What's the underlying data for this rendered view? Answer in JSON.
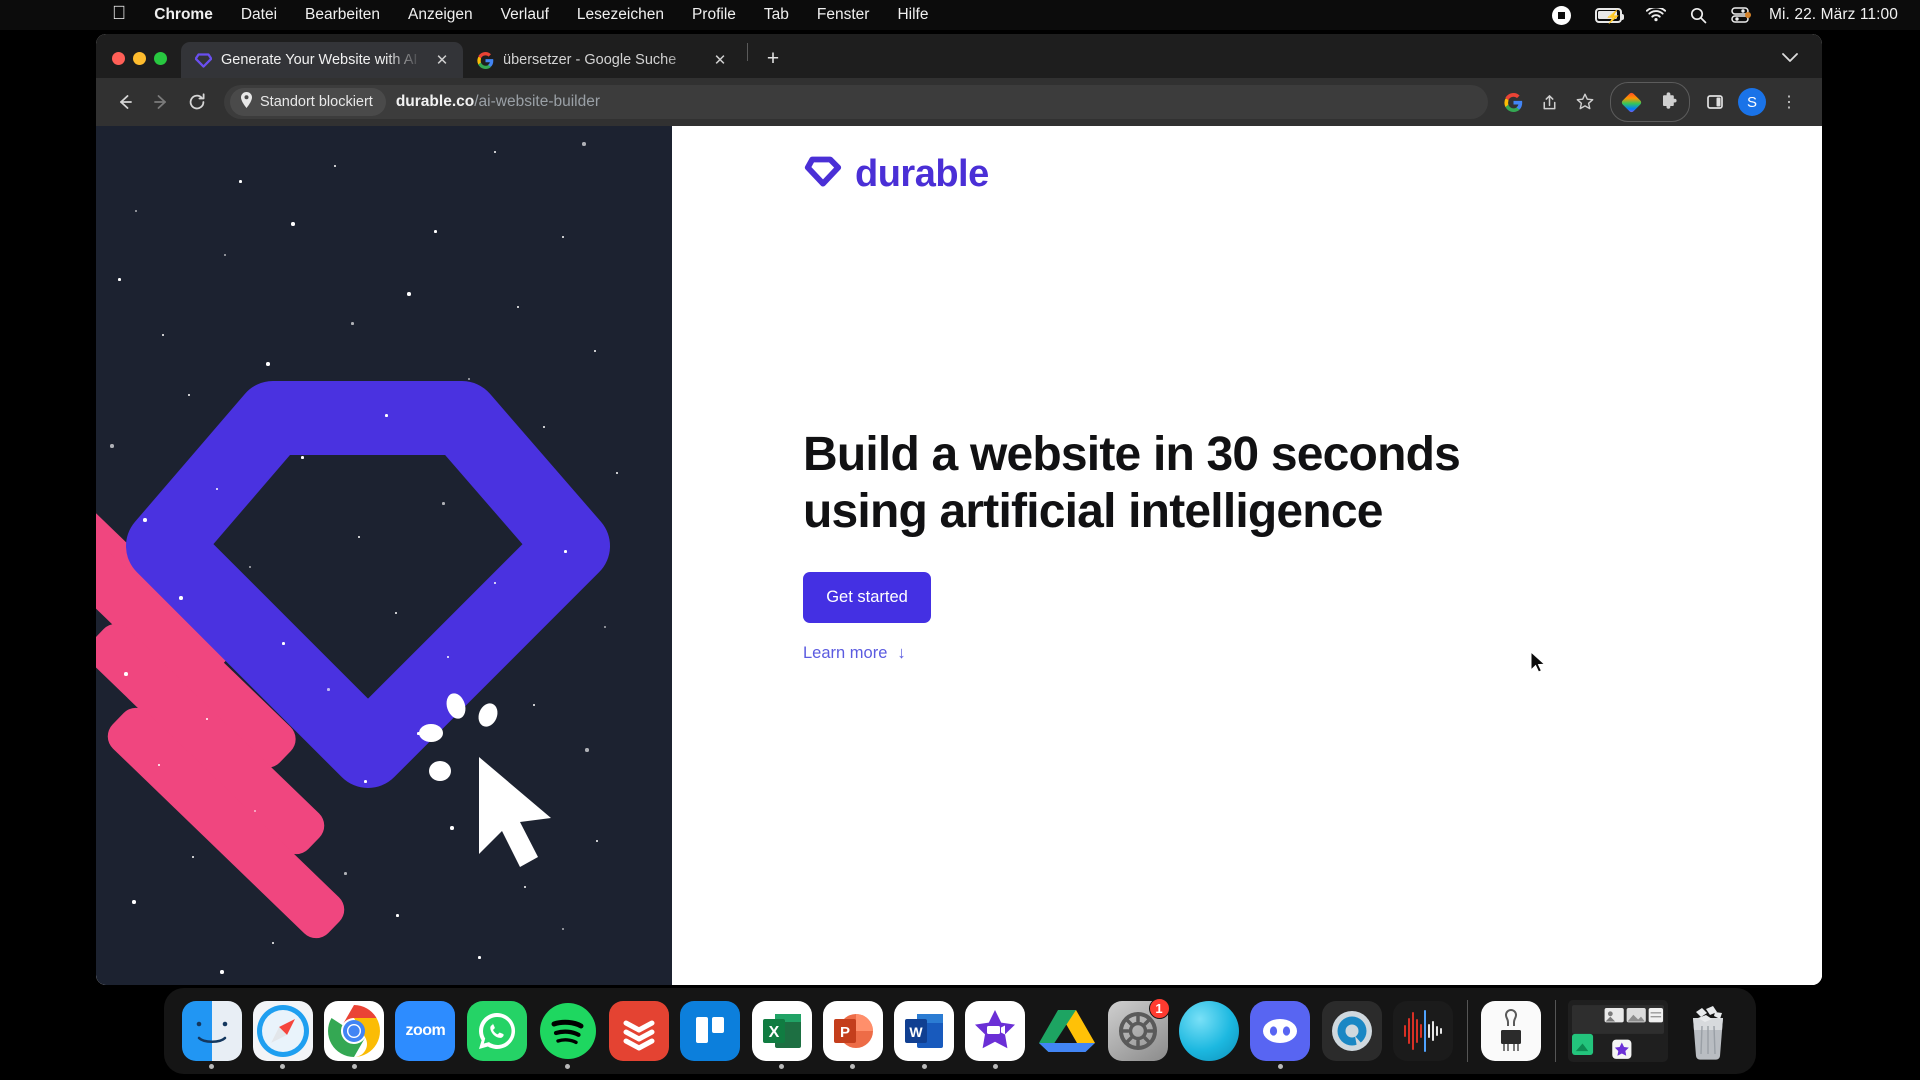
{
  "menubar": {
    "apple_icon": "apple-logo",
    "items": [
      {
        "label": "Chrome",
        "bold": true
      },
      {
        "label": "Datei",
        "bold": false
      },
      {
        "label": "Bearbeiten",
        "bold": false
      },
      {
        "label": "Anzeigen",
        "bold": false
      },
      {
        "label": "Verlauf",
        "bold": false
      },
      {
        "label": "Lesezeichen",
        "bold": false
      },
      {
        "label": "Profile",
        "bold": false
      },
      {
        "label": "Tab",
        "bold": false
      },
      {
        "label": "Fenster",
        "bold": false
      },
      {
        "label": "Hilfe",
        "bold": false
      }
    ],
    "status_icons": [
      "screen-record-icon",
      "battery-charging-icon",
      "wifi-icon",
      "spotlight-search-icon",
      "control-center-icon"
    ],
    "clock": "Mi. 22. März  11:00"
  },
  "browser": {
    "window_controls": [
      "close-button",
      "minimize-button",
      "maximize-button"
    ],
    "tabs": [
      {
        "title": "Generate Your Website with AI",
        "favicon": "durable-diamond-icon",
        "active": true,
        "close_label": "✕"
      },
      {
        "title": "übersetzer - Google Suche",
        "favicon": "google-icon",
        "active": false,
        "close_label": "✕"
      }
    ],
    "new_tab_label": "+",
    "tab_list_caret": "⌄",
    "toolbar": {
      "back_label": "←",
      "forward_label": "→",
      "reload_label": "↻",
      "location_chip": "Standort blockiert",
      "location_chip_icon": "location-pin-icon",
      "url_host": "durable.co",
      "url_path": "/ai-website-builder",
      "right_icons": [
        "google-lens-icon",
        "share-icon",
        "bookmark-star-icon",
        "rainbow-extension-icon",
        "extensions-puzzle-icon",
        "side-panel-icon"
      ],
      "profile_initial": "S",
      "menu_label": "⋮"
    }
  },
  "page": {
    "logo_text": "durable",
    "logo_icon": "durable-diamond-icon",
    "headline": "Build a website in 30 seconds using artificial intelligence",
    "cta_label": "Get started",
    "learn_more_label": "Learn more",
    "learn_more_arrow": "↓",
    "colors": {
      "brand_purple": "#4a2fd6",
      "cta_purple": "#4430e3",
      "art_background": "#1c2230",
      "art_pink": "#f0467f",
      "art_blue": "#4a32e0"
    },
    "art": {
      "name": "durable-diamond-illustration",
      "elements": [
        "diamond-outline",
        "pink-stripes",
        "cursor-click",
        "starfield"
      ]
    }
  },
  "dock": {
    "items": [
      {
        "name": "finder",
        "label": "Finder",
        "running": true
      },
      {
        "name": "safari",
        "label": "Safari",
        "running": true
      },
      {
        "name": "chrome",
        "label": "Google Chrome",
        "running": true
      },
      {
        "name": "zoom",
        "label": "zoom",
        "running": false
      },
      {
        "name": "whatsapp",
        "label": "WhatsApp",
        "running": false
      },
      {
        "name": "spotify",
        "label": "Spotify",
        "running": true
      },
      {
        "name": "todoist",
        "label": "Todoist",
        "running": false
      },
      {
        "name": "trello",
        "label": "Trello",
        "running": false
      },
      {
        "name": "excel",
        "label": "Microsoft Excel",
        "running": true
      },
      {
        "name": "powerpoint",
        "label": "Microsoft PowerPoint",
        "running": true
      },
      {
        "name": "word",
        "label": "Microsoft Word",
        "running": true
      },
      {
        "name": "imovie",
        "label": "iMovie",
        "running": true
      },
      {
        "name": "google-drive",
        "label": "Google Drive",
        "running": false
      },
      {
        "name": "system-settings",
        "label": "Systemeinstellungen",
        "running": false,
        "badge": "1"
      },
      {
        "name": "blue-sphere-app",
        "label": "App",
        "running": false
      },
      {
        "name": "discord",
        "label": "Discord",
        "running": true
      },
      {
        "name": "quicktime",
        "label": "QuickTime Player",
        "running": false
      },
      {
        "name": "audio-waveform-app",
        "label": "Audio",
        "running": false
      }
    ],
    "folder_items": [
      {
        "name": "circuit-app",
        "label": "Downloads"
      },
      {
        "name": "stack-folder",
        "label": "Stack"
      },
      {
        "name": "trash",
        "label": "Papierkorb"
      }
    ]
  }
}
